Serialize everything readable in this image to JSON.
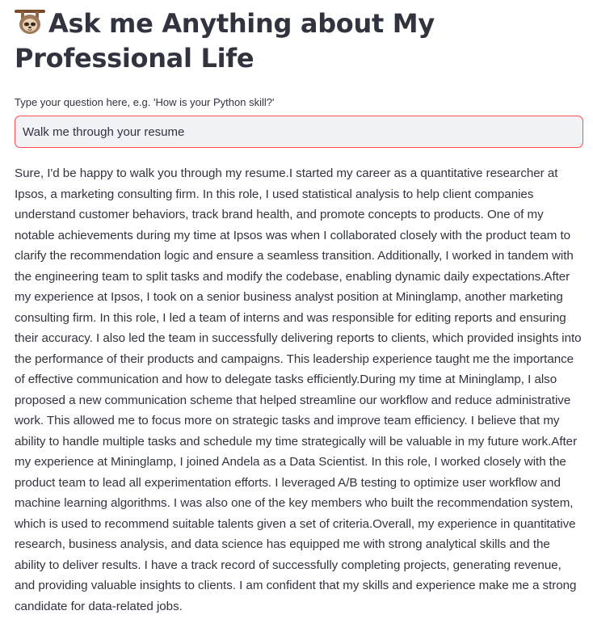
{
  "header": {
    "icon": "sloth-icon",
    "title": "Ask me Anything about My Professional Life"
  },
  "question": {
    "label": "Type your question here, e.g. 'How is your Python skill?'",
    "value": "Walk me through your resume",
    "border_color": "#ff4b4b",
    "background": "#f0f2f6"
  },
  "answer": {
    "text": "Sure, I'd be happy to walk you through my resume.I started my career as a quantitative researcher at Ipsos, a marketing consulting firm. In this role, I used statistical analysis to help client companies understand customer behaviors, track brand health, and promote concepts to products. One of my notable achievements during my time at Ipsos was when I collaborated closely with the product team to clarify the recommendation logic and ensure a seamless transition. Additionally, I worked in tandem with the engineering team to split tasks and modify the codebase, enabling dynamic daily expectations.After my experience at Ipsos, I took on a senior business analyst position at Mininglamp, another marketing consulting firm. In this role, I led a team of interns and was responsible for editing reports and ensuring their accuracy. I also led the team in successfully delivering reports to clients, which provided insights into the performance of their products and campaigns. This leadership experience taught me the importance of effective communication and how to delegate tasks efficiently.During my time at Mininglamp, I also proposed a new communication scheme that helped streamline our workflow and reduce administrative work. This allowed me to focus more on strategic tasks and improve team efficiency. I believe that my ability to handle multiple tasks and schedule my time strategically will be valuable in my future work.After my experience at Mininglamp, I joined Andela as a Data Scientist. In this role, I worked closely with the product team to lead all experimentation efforts. I leveraged A/B testing to optimize user workflow and machine learning algorithms. I was also one of the key members who built the recommendation system, which is used to recommend suitable talents given a set of criteria.Overall, my experience in quantitative research, business analysis, and data science has equipped me with strong analytical skills and the ability to deliver results. I have a track record of successfully completing projects, generating revenue, and providing valuable insights to clients. I am confident that my skills and experience make me a strong candidate for data-related jobs."
  }
}
